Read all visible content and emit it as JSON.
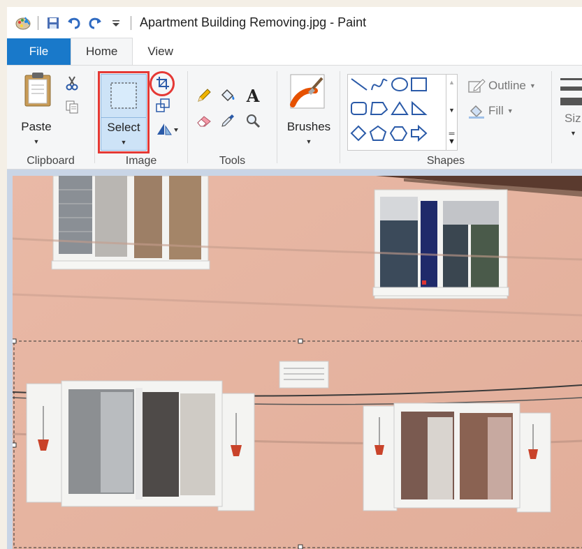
{
  "window": {
    "title": "Apartment Building Removing.jpg - Paint"
  },
  "tabs": [
    {
      "label": "File"
    },
    {
      "label": "Home"
    },
    {
      "label": "View"
    }
  ],
  "ribbon": {
    "clipboard": {
      "paste_label": "Paste",
      "group_label": "Clipboard"
    },
    "image": {
      "select_label": "Select",
      "group_label": "Image"
    },
    "tools": {
      "group_label": "Tools"
    },
    "brushes": {
      "label": "Brushes"
    },
    "shapes": {
      "outline_label": "Outline",
      "fill_label": "Fill",
      "group_label": "Shapes"
    },
    "size": {
      "label": "Siz"
    }
  },
  "annotations": {
    "highlight_color": "#e53935"
  },
  "colors": {
    "file_tab": "#1979ca",
    "ribbon_bg": "#f5f6f7",
    "wall": "#e9b9a6"
  }
}
